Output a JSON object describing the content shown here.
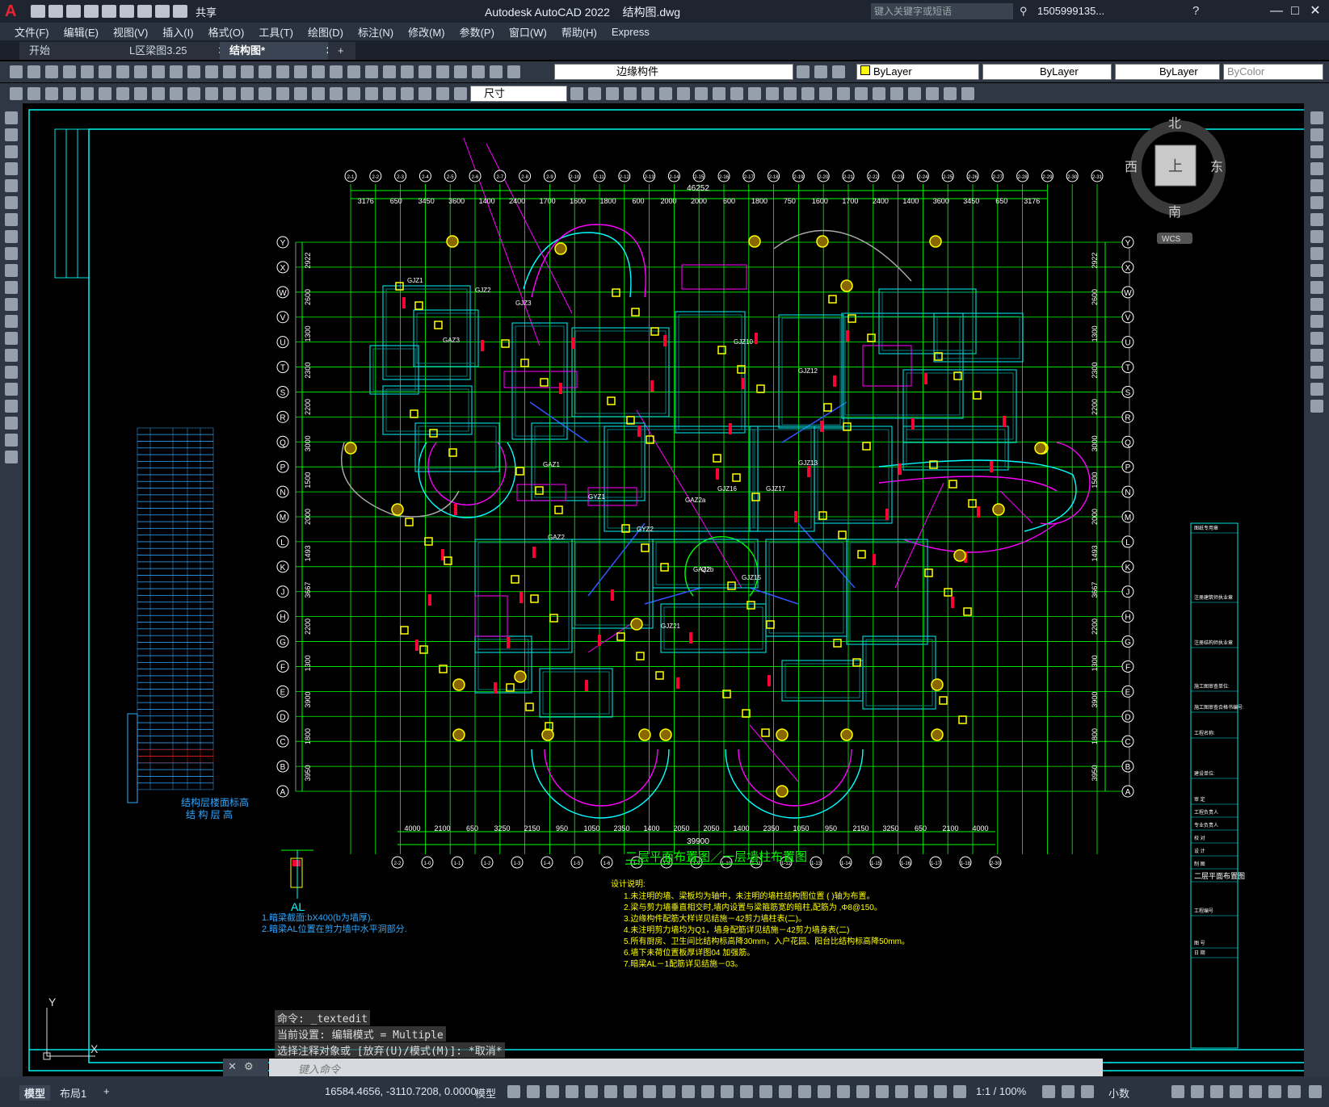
{
  "titlebar": {
    "app_title": "Autodesk AutoCAD 2022",
    "file_name": "结构图.dwg",
    "share_label": "共享",
    "search_placeholder": "键入关键字或短语",
    "user": "1505999135..."
  },
  "menu": [
    "文件(F)",
    "编辑(E)",
    "视图(V)",
    "插入(I)",
    "格式(O)",
    "工具(T)",
    "绘图(D)",
    "标注(N)",
    "修改(M)",
    "参数(P)",
    "窗口(W)",
    "帮助(H)",
    "Express"
  ],
  "tabs": [
    {
      "label": "开始",
      "active": false
    },
    {
      "label": "L区梁图3.25",
      "active": false
    },
    {
      "label": "结构图*",
      "active": true
    }
  ],
  "toolbar": {
    "layer_value": "边缘构件",
    "color_value": "ByLayer",
    "linetype_value": "ByLayer",
    "lineweight_value": "ByLayer",
    "plotstyle_value": "ByColor",
    "dimstyle_value": "尺寸"
  },
  "viewcube": {
    "north": "北",
    "south": "南",
    "east": "东",
    "west": "西",
    "top": "上",
    "wcs": "WCS"
  },
  "drawing": {
    "title": "二层平面布置图／一层墙柱布置图",
    "notes_title": "设计说明:",
    "notes": [
      "1.未注明的墙、梁板均为轴中，未注明的墙柱结构图位置      (   )轴为布置。",
      "2.梁与剪力墙垂直相交时,墙内设置与梁箍筋宽的暗柱,配筋为       ,Φ8@150。",
      "3.边缘构件配筋大样详见结施－42剪力墙柱表(二)。",
      "4.未注明剪力墙均为Q1，墙身配筋详见结施－42剪力墙身表(二)",
      "5.所有厨房、卫生间比结构标高降30mm，入户花园、阳台比结构标高降50mm。",
      "6.墙下未荷位置板厚详图04       加强筋。",
      "7.暗梁AL－1配筋详见结施－03。"
    ],
    "al_notes": [
      "1.暗梁截面:bX400(b为墙厚).",
      "2.暗梁AL位置在剪力墙中水平洞部分."
    ],
    "al_label": "AL",
    "table_title_1": "结构层楼面标高",
    "table_title_2": "结 构 层 高",
    "top_dims": [
      "3176",
      "650",
      "3450",
      "3600",
      "1400",
      "2400",
      "1700",
      "1600",
      "1800",
      "600",
      "2000",
      "2000",
      "600",
      "1800",
      "750",
      "1600",
      "1700",
      "2400",
      "1400",
      "3600",
      "3450",
      "650",
      "3176"
    ],
    "top_total": "46252",
    "bottom_dims": [
      "4000",
      "2100",
      "650",
      "3250",
      "2150",
      "950",
      "1050",
      "2350",
      "1400",
      "2050",
      "2050",
      "1400",
      "2350",
      "1050",
      "950",
      "2150",
      "3250",
      "650",
      "2100",
      "4000"
    ],
    "bottom_total": "39900",
    "row_axes": [
      "Y",
      "X",
      "W",
      "V",
      "U",
      "T",
      "S",
      "R",
      "Q",
      "P",
      "N",
      "M",
      "L",
      "K",
      "J",
      "H",
      "G",
      "F",
      "E",
      "D",
      "C",
      "B",
      "A"
    ],
    "left_row_dims": [
      "2922",
      "2600",
      "1300",
      "2300",
      "2200",
      "3000",
      "1500",
      "2000",
      "1493",
      "3667",
      "2200",
      "1300",
      "3900",
      "1800",
      "3950"
    ],
    "top_axes": [
      "2-1",
      "2-2",
      "2-3",
      "2-4",
      "2-5",
      "2-6",
      "2-7",
      "2-8",
      "2-9",
      "2-10",
      "2-11",
      "2-12",
      "2-13",
      "2-14",
      "2-15",
      "2-16",
      "2-17",
      "2-18",
      "2-19",
      "2-20",
      "2-21",
      "2-22",
      "2-23",
      "2-24",
      "2-25",
      "2-26",
      "2-27",
      "2-28",
      "2-29",
      "2-30",
      "2-31"
    ],
    "bottom_axes": [
      "2-2",
      "1-0",
      "1-1",
      "1-2",
      "1-3",
      "1-4",
      "1-5",
      "1-6",
      "1-7",
      "1-8",
      "1-9",
      "1-10",
      "1-11",
      "1-12",
      "1-13",
      "1-14",
      "1-15",
      "1-16",
      "1-17",
      "1-18",
      "2-30"
    ],
    "wall_labels": [
      "GJZ1",
      "GJZ2",
      "GJZ3",
      "GAZ1",
      "GAZ2",
      "GAZ3",
      "GJZ10",
      "GJZ12",
      "GJZ13",
      "GJZ15",
      "GJZ16",
      "GJZ17",
      "Q2",
      "GYZ1",
      "GYZ2",
      "GAZ2a",
      "GAZ2b",
      "GJZ21"
    ]
  },
  "title_block": [
    "图纸专用章",
    "注册建筑师执业章",
    "注册结构师执业章",
    "施工图审查单位:",
    "施工图审查合格书编号:",
    "工程名称:",
    "建设单位:",
    "审 定",
    "工程负责人",
    "专业负责人",
    "校 对",
    "设 计",
    "制 图",
    "二层平面布置图",
    "工程编号",
    "图 号",
    "日 期"
  ],
  "command": {
    "history": [
      "命令: _textedit",
      "当前设置: 编辑模式 = Multiple",
      "选择注释对象或 [放弃(U)/模式(M)]: *取消*"
    ],
    "placeholder": "键入命令"
  },
  "layout_tabs": [
    "模型",
    "布局1"
  ],
  "status": {
    "coords": "16584.4656, -3110.7208, 0.0000",
    "space": "模型",
    "scale": "1:1 / 100%",
    "units": "小数"
  },
  "colors": {
    "grid": "#00ff00",
    "wall": "#00ffff",
    "dim": "#00ff00",
    "magenta": "#ff00ff",
    "column": "#ffff00",
    "red": "#ff0033",
    "frame": "#00e5e5"
  }
}
